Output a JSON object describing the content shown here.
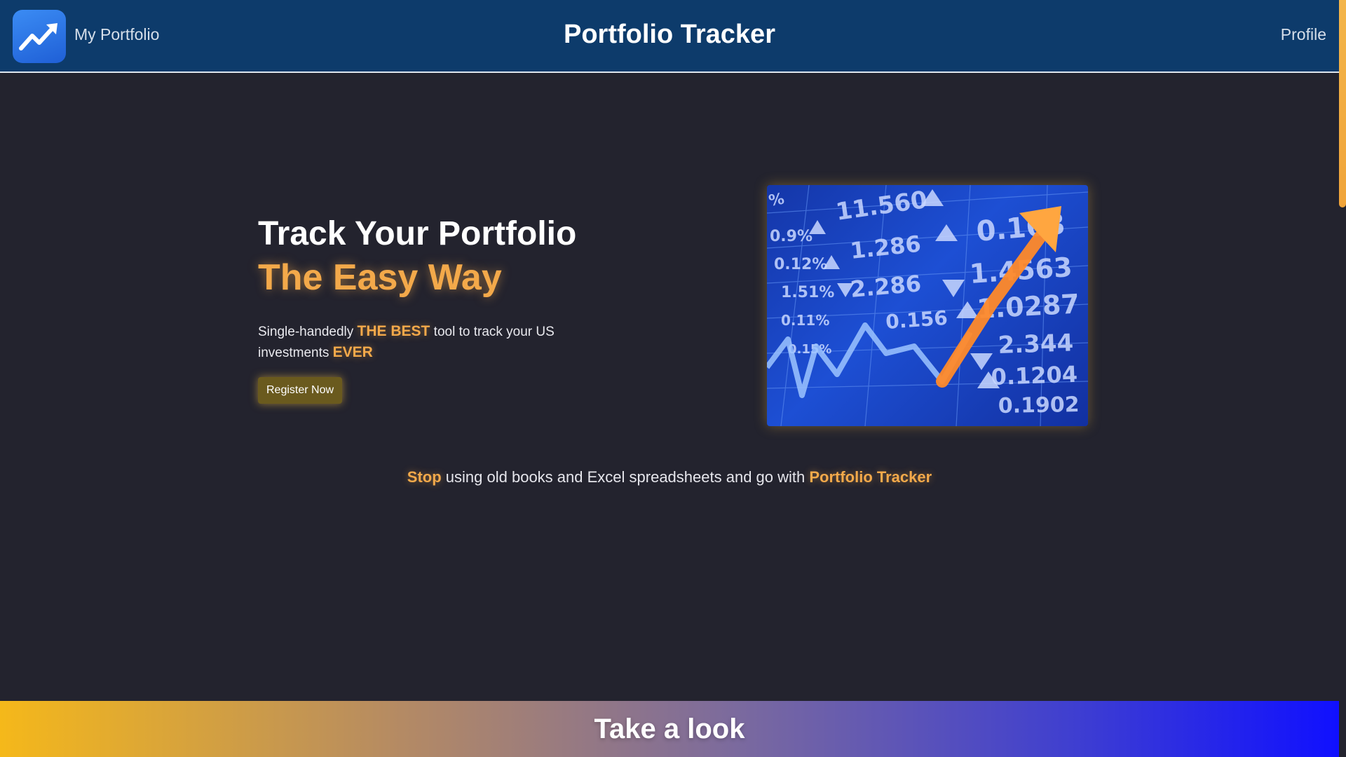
{
  "header": {
    "brand_label": "My Portfolio",
    "title": "Portfolio Tracker",
    "profile_label": "Profile",
    "logo_icon": "trending-up-icon"
  },
  "hero": {
    "title": "Track Your Portfolio",
    "accent": "The Easy Way",
    "desc_part1": "Single-handedly ",
    "desc_highlight1": "THE BEST",
    "desc_part2": " tool to track your US investments ",
    "desc_highlight2": "EVER",
    "register_label": "Register Now",
    "image_icon": "stock-market-chart-image"
  },
  "tagline": {
    "highlight1": "Stop",
    "middle": " using old books and Excel spreadsheets and go with ",
    "highlight2": "Portfolio Tracker"
  },
  "banner": {
    "title": "Take a look"
  },
  "colors": {
    "header_bg": "#0d3b6b",
    "page_bg": "#23232e",
    "accent": "#f3a94a",
    "button_bg": "#6a5a1e"
  }
}
